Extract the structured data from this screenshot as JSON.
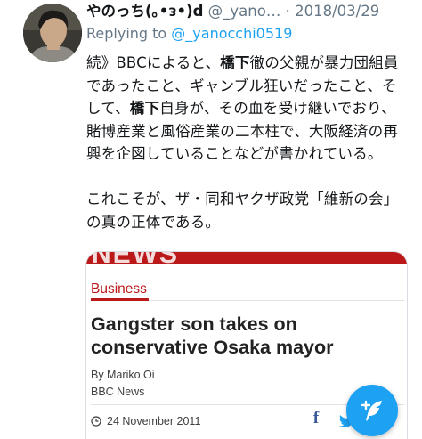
{
  "tweet": {
    "display_name": "やのっち(｡•ᴈ•)d",
    "handle": "@_yano…",
    "separator": "·",
    "date": "2018/03/29",
    "reply_prefix": "Replying to",
    "reply_to": "@_yanocchi0519",
    "text": {
      "p1_a": "続》BBCによると、",
      "p1_b": "橋下",
      "p1_c": "徹の父親が暴力団組員であったこと、ギャンブル狂いだったこと、そして、",
      "p1_d": "橋下",
      "p1_e": "自身が、その血を受け継いでおり、賭博産業と風俗産業の二本柱で、大阪経済の再興を企図していることなどが書かれている。",
      "p2": "これこそが、ザ・同和ヤクザ政党「維新の会」の真の正体である。"
    }
  },
  "card": {
    "masthead": "NEWS",
    "section": "Business",
    "headline": "Gangster son takes on conservative Osaka mayor",
    "byline": "By Mariko Oi",
    "source": "BBC News",
    "date": "24 November 2011",
    "share_icons": [
      "facebook-icon",
      "twitter-icon"
    ]
  },
  "compose_fab": {
    "icon": "compose-feather-icon"
  },
  "colors": {
    "link_blue": "#1da1f2",
    "meta_gray": "#657786",
    "bbc_red": "#bb1919",
    "facebook_blue": "#3b5998"
  }
}
